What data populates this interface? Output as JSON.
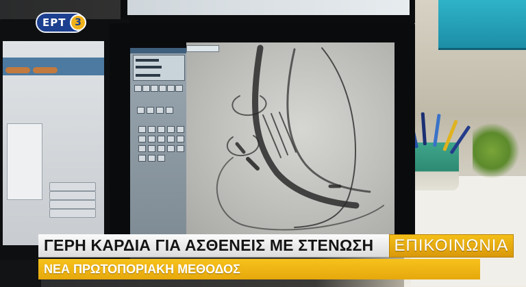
{
  "channel_logo": {
    "text": "ΕΡΤ",
    "badge": "3",
    "color": "#1c3f8f",
    "badge_color": "#f0b21a"
  },
  "lower_third": {
    "headline": "ΓΕΡΗ ΚΑΡΔΙΑ ΓΙΑ ΑΣΘΕΝΕΙΣ ΜΕ ΣΤΕΝΩΣΗ",
    "subheadline": "ΝΕΑ ΠΡΩΤΟΠΟΡΙΑΚΗ ΜΕΘΟΔΟΣ",
    "brand": "ΕΠΙΚΟΙΝΩΝΙΑ",
    "accent_color": "#f0b21a",
    "headline_bg": "#f5f5f5"
  },
  "scene": {
    "description_icons": [
      "monitor-icon",
      "xray-image",
      "pen-cup"
    ]
  }
}
